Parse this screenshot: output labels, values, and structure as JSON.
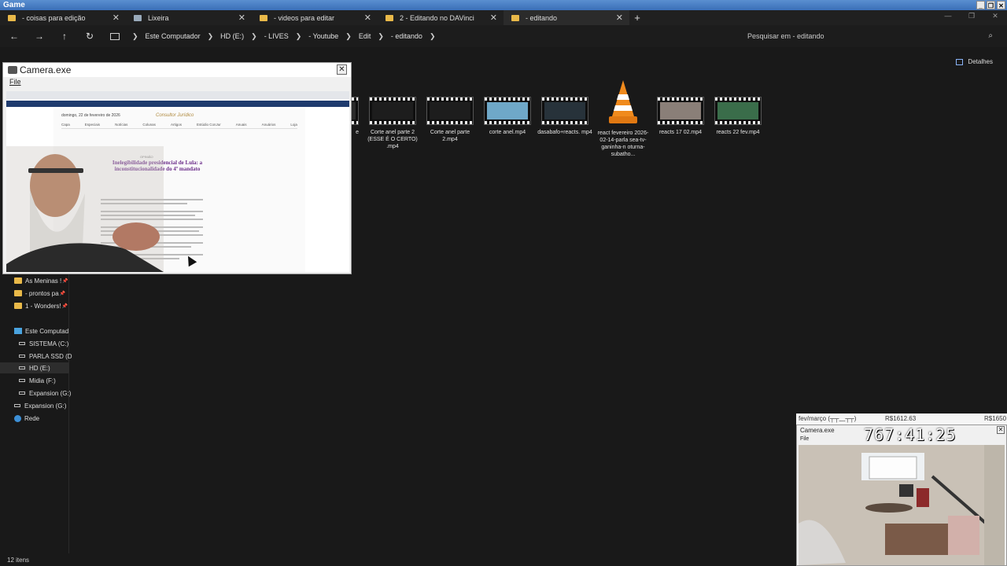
{
  "window_title": "Game",
  "tabs": [
    {
      "label": "- coisas para edição",
      "icon": "folder-icon"
    },
    {
      "label": "Lixeira",
      "icon": "recycle-bin-icon"
    },
    {
      "label": "- videos para editar",
      "icon": "folder-icon"
    },
    {
      "label": "2 - Editando no DAVinci",
      "icon": "folder-icon"
    },
    {
      "label": "- editando",
      "icon": "folder-icon",
      "active": true
    }
  ],
  "tab_add": "+",
  "breadcrumbs": [
    "Este Computador",
    "HD (E:)",
    "- LIVES",
    "- Youtube",
    "Edit",
    "- editando"
  ],
  "search": {
    "placeholder": "Pesquisar em - editando"
  },
  "details_label": "Detalhes",
  "sidebar": {
    "items": [
      {
        "label": "As Meninas !",
        "type": "folder",
        "pinned": true
      },
      {
        "label": "- prontos pa",
        "type": "folder",
        "pinned": true
      },
      {
        "label": "1 - Wonders!",
        "type": "folder",
        "pinned": true
      },
      {
        "label": "Este Computad",
        "type": "pc"
      },
      {
        "label": "SISTEMA (C:)",
        "type": "drive"
      },
      {
        "label": "PARLA SSD (D",
        "type": "drive"
      },
      {
        "label": "HD (E:)",
        "type": "drive",
        "selected": true
      },
      {
        "label": "Midia (F:)",
        "type": "drive"
      },
      {
        "label": "Expansion (G:)",
        "type": "drive"
      },
      {
        "label": "Expansion (G:)",
        "type": "drive"
      },
      {
        "label": "Rede",
        "type": "network"
      }
    ]
  },
  "files": [
    {
      "label": "e",
      "type": "video",
      "tint": "#2a2a2a"
    },
    {
      "label": "Corte anel parte 2 (ESSE É O CERTO) .mp4",
      "type": "video",
      "tint": "#1d1d1d"
    },
    {
      "label": "Corte anel parte 2.mp4",
      "type": "video",
      "tint": "#1d1d1d"
    },
    {
      "label": "corte anel.mp4",
      "type": "video",
      "tint": "#6fa8c8"
    },
    {
      "label": "dasabafo+reacts. mp4",
      "type": "video",
      "tint": "#27323a"
    },
    {
      "label": "react fevereiro 2026-02-14-parla sea-tv-ganinha-n oturna-subatho...",
      "type": "vlc"
    },
    {
      "label": "reacts 17 02.mp4",
      "type": "video",
      "tint": "#8a7f78"
    },
    {
      "label": "reacts 22 fev.mp4",
      "type": "video",
      "tint": "#3a6d4a"
    }
  ],
  "status": {
    "count": "12 itens"
  },
  "camera_window": {
    "title": "Camera.exe",
    "menu": "File",
    "site": {
      "date": "domingo, 22 de fevereiro de 2026",
      "logo": "Consultor Jurídico",
      "menu": [
        "Capa",
        "Especiais",
        "Notícias",
        "Colunas",
        "Artigos",
        "Estúdio ConJur",
        "Anuais",
        "Anuários",
        "Loja"
      ],
      "kicker": "OPINIÃO",
      "headline": "Inelegibilidade presidencial de Lula: a inconstitucionalidade do 4º mandato"
    }
  },
  "ticker": {
    "period": "fev/março",
    "emoticon": "(┬┬﹏┬┬)",
    "amount": "R$1612.63",
    "goal": "R$1650"
  },
  "camera2": {
    "title": "Camera.exe",
    "menu": "File",
    "timer": "767:41:25"
  },
  "colors": {
    "accent": "#e9b949",
    "titlebar": "#3a6fb8",
    "headline": "#6b2c8a"
  }
}
